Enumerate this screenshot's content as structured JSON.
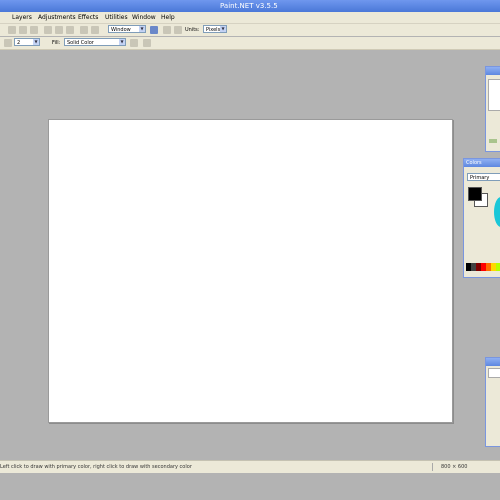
{
  "window": {
    "title": "Paint.NET v3.5.5"
  },
  "menu": [
    "Layers",
    "Adjustments",
    "Effects",
    "Utilities",
    "Window",
    "Help"
  ],
  "toolbar": {
    "window_dropdown": "Window",
    "units_label": "Units:",
    "units_value": "Pixels",
    "brush_width": "2",
    "fill_label": "Fill:",
    "fill_value": "Solid Color"
  },
  "colors_panel": {
    "title": "Colors",
    "selector": "Primary",
    "primary_color": "#000000",
    "secondary_color": "#ffffff"
  },
  "status": {
    "hint": "Left click to draw with primary color, right click to draw with secondary color",
    "size": "800 × 600"
  }
}
